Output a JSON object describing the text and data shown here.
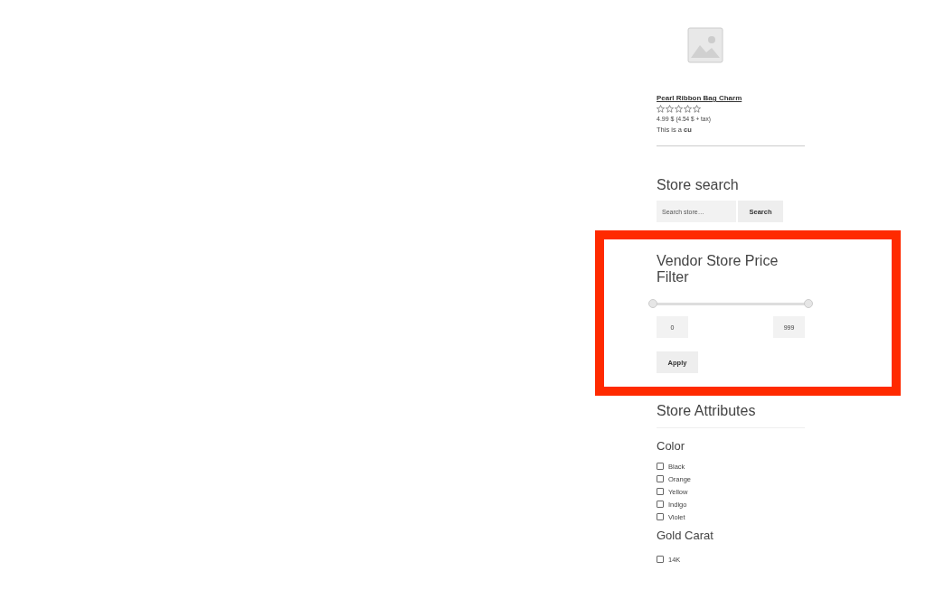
{
  "product": {
    "kind": "picture",
    "title": "Pearl Ribbon Bag Charm",
    "stars": 0,
    "price": "4.99 $",
    "price_note": "(4.54 $ + tax)",
    "description": "This is a **cu**"
  },
  "store_search": {
    "title": "Store search",
    "placeholder": "Search store…",
    "button": "Search"
  },
  "price_filter": {
    "title": "Vendor Store Price Filter",
    "thumbs": [
      {
        "level": 0
      },
      {
        "level": 1
      }
    ],
    "min": "0",
    "max": "999",
    "button": "Apply"
  },
  "attributes": {
    "title": "Store Attributes",
    "groups": [
      {
        "title": "Color",
        "options": [
          {
            "label": "Black",
            "checked": false
          },
          {
            "label": "Orange",
            "checked": false
          },
          {
            "label": "Yellow",
            "checked": false
          },
          {
            "label": "Indigo",
            "checked": false
          },
          {
            "label": "Violet",
            "checked": false
          }
        ]
      },
      {
        "title": "Gold Carat",
        "options": [
          {
            "label": "14K",
            "checked": false
          }
        ]
      }
    ]
  }
}
